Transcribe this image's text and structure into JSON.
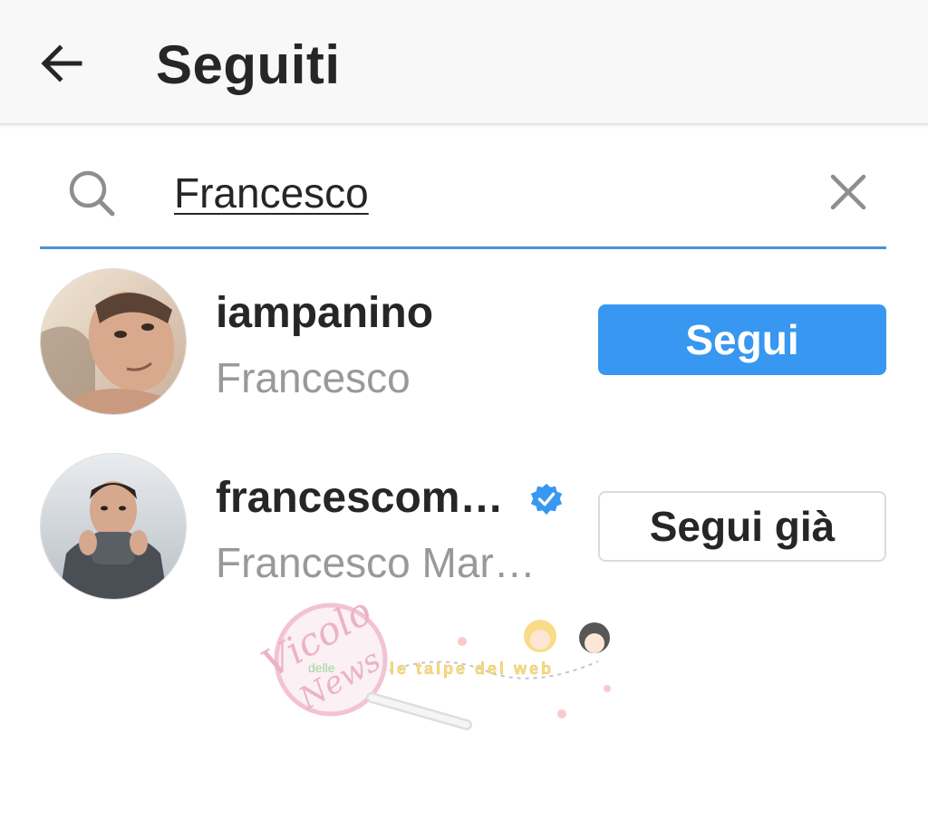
{
  "header": {
    "back_icon": "arrow-left-icon",
    "title": "Seguiti"
  },
  "search": {
    "icon": "search-icon",
    "value": "Francesco",
    "clear_icon": "close-icon",
    "underline_color": "#4a90d9"
  },
  "results": [
    {
      "username": "iampanino",
      "full_name": "Francesco",
      "verified": false,
      "button_label": "Segui",
      "button_style": "primary"
    },
    {
      "username": "francescom…",
      "full_name": "Francesco Mar…",
      "verified": true,
      "button_label": "Segui già",
      "button_style": "outline"
    }
  ],
  "watermark": {
    "text_main": "Vicolo",
    "text_small": "delle",
    "text_news": "News",
    "text_tagline": "le talpe del web"
  },
  "colors": {
    "accent": "#3897f0",
    "verified": "#3897f0",
    "secondary_text": "#999999"
  }
}
